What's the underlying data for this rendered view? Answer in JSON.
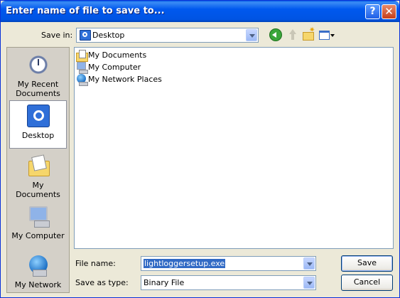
{
  "window": {
    "title": "Enter name of file to save to...",
    "help_icon": "?",
    "close_icon": "✕"
  },
  "toolbar": {
    "save_in_label": "Save in:",
    "save_in_value": "Desktop",
    "icons": [
      "back-icon",
      "up-folder-icon",
      "new-folder-icon",
      "views-menu-icon"
    ]
  },
  "places": [
    {
      "label": "My Recent Documents",
      "icon": "recent-documents-icon"
    },
    {
      "label": "Desktop",
      "icon": "desktop-icon",
      "selected": true
    },
    {
      "label": "My Documents",
      "icon": "my-documents-icon"
    },
    {
      "label": "My Computer",
      "icon": "my-computer-icon"
    },
    {
      "label": "My Network",
      "icon": "my-network-icon"
    }
  ],
  "files": [
    {
      "name": "My Documents",
      "icon": "my-documents-icon"
    },
    {
      "name": "My Computer",
      "icon": "my-computer-icon"
    },
    {
      "name": "My Network Places",
      "icon": "network-places-icon"
    }
  ],
  "form": {
    "file_name_label": "File name:",
    "file_name_value": "lightloggersetup.exe",
    "save_as_type_label": "Save as type:",
    "save_as_type_value": "Binary File"
  },
  "buttons": {
    "save": "Save",
    "cancel": "Cancel"
  }
}
